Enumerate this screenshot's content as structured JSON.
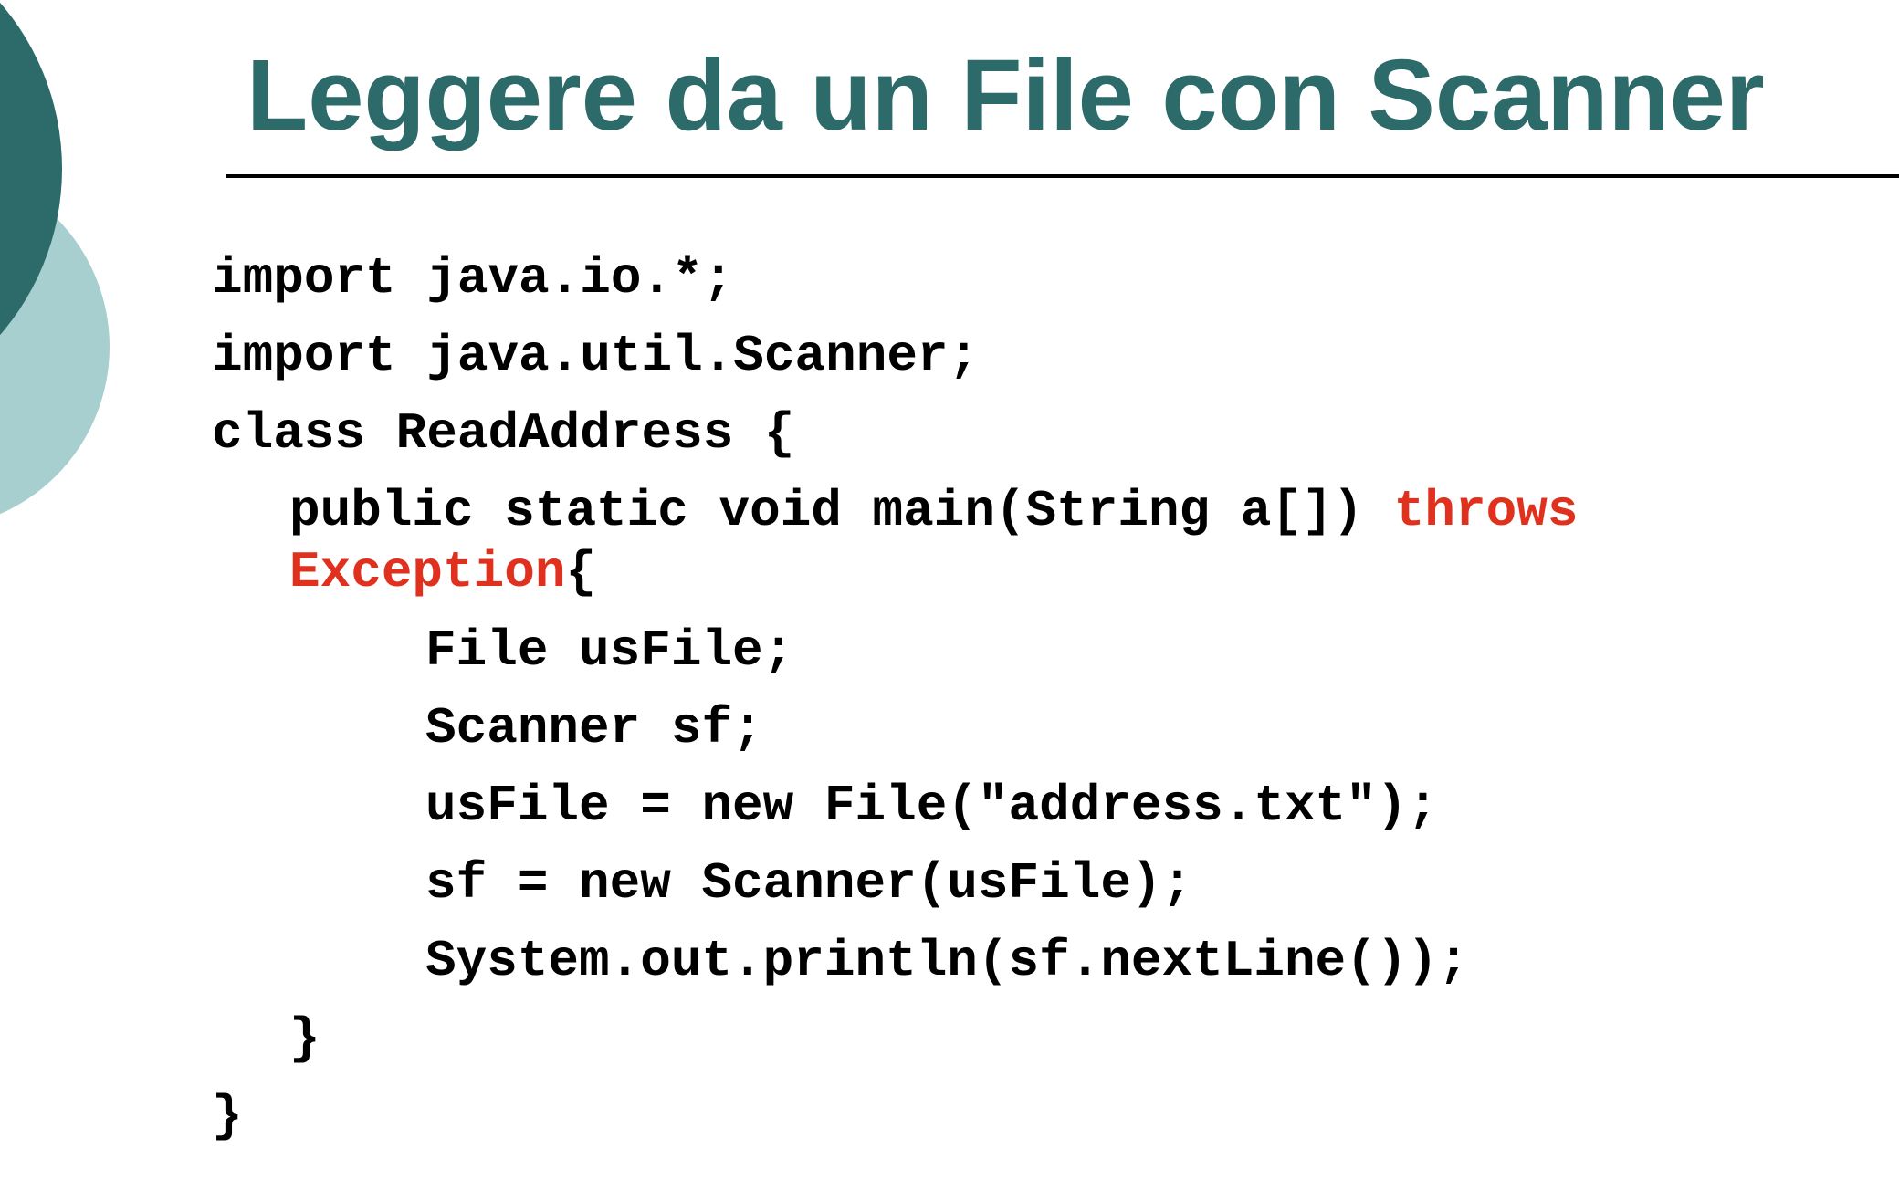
{
  "slide": {
    "title": "Leggere da un File con Scanner",
    "colors": {
      "title": "#2d6a6a",
      "accent_dark": "#2d6a6a",
      "accent_light": "#a8cfd0",
      "code_text": "#000000",
      "keyword": "#e0301e"
    }
  },
  "code": {
    "line1": "import java.io.*;",
    "line2": "import java.util.Scanner;",
    "line3": "class ReadAddress {",
    "line4_prefix": "public static void main(String a[]) ",
    "line4_keyword": "throws",
    "line5_keyword": "Exception",
    "line5_suffix": "{",
    "line6": "File usFile;",
    "line7": "Scanner sf;",
    "line8": "usFile = new File(\"address.txt\");",
    "line9": "sf = new Scanner(usFile);",
    "line10": "System.out.println(sf.nextLine());",
    "line11": "}",
    "line12": "}"
  }
}
